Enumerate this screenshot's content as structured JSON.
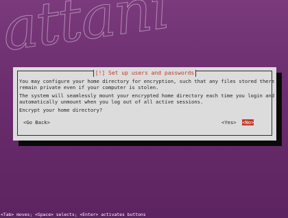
{
  "dialog": {
    "title": "[!] Set up users and passwords",
    "paragraphs": [
      "You may configure your home directory for encryption, such that any files stored there",
      "remain private even if your computer is stolen.",
      "The system will seamlessly mount your encrypted home directory each time you login and",
      "automatically unmount when you log out of all active sessions.",
      "Encrypt your home directory?"
    ],
    "buttons": {
      "go_back": "<Go Back>",
      "yes": "<Yes>",
      "no": "<No>"
    },
    "selected_button": "no"
  },
  "status_bar": {
    "text": "<Tab> moves; <Space> selects; <Enter> activates buttons"
  },
  "watermark": {
    "text": "attani"
  },
  "colors": {
    "background": "#6b2e6e",
    "dialog_bg": "#dcdcdc",
    "accent_red": "#c2382b",
    "shadow": "#0a0a0a"
  }
}
